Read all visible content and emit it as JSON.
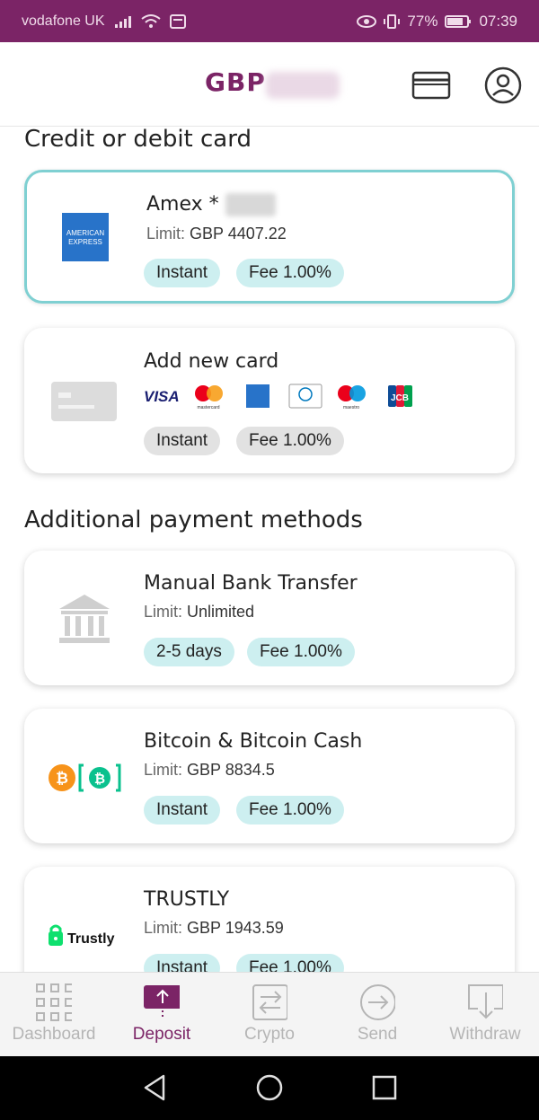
{
  "status_bar": {
    "carrier": "vodafone UK",
    "battery": "77%",
    "time": "07:39"
  },
  "header": {
    "currency": "GBP"
  },
  "sections": {
    "cards_title": "Credit or debit card",
    "additional_title": "Additional payment methods"
  },
  "cards": {
    "amex": {
      "title": "Amex *",
      "limit_label": "Limit:",
      "limit_value": "GBP 4407.22",
      "speed": "Instant",
      "fee": "Fee 1.00%",
      "logo_text_1": "AMERICAN",
      "logo_text_2": "EXPRESS"
    },
    "add_new": {
      "title": "Add new card",
      "speed": "Instant",
      "fee": "Fee 1.00%",
      "brands": {
        "visa": "VISA",
        "mastercard": "mastercard",
        "maestro": "maestro",
        "jcb": "JCB"
      }
    }
  },
  "methods": {
    "bank": {
      "title": "Manual Bank Transfer",
      "limit_label": "Limit:",
      "limit_value": "Unlimited",
      "speed": "2-5 days",
      "fee": "Fee 1.00%"
    },
    "bitcoin": {
      "title": "Bitcoin & Bitcoin Cash",
      "limit_label": "Limit:",
      "limit_value": "GBP 8834.5",
      "speed": "Instant",
      "fee": "Fee 1.00%"
    },
    "trustly": {
      "title": "TRUSTLY",
      "limit_label": "Limit:",
      "limit_value": "GBP 1943.59",
      "speed": "Instant",
      "fee": "Fee 1.00%",
      "logo_text": "Trustly"
    }
  },
  "tabs": [
    {
      "label": "Dashboard",
      "icon": "grid-icon"
    },
    {
      "label": "Deposit",
      "icon": "upload-icon"
    },
    {
      "label": "Crypto",
      "icon": "exchange-icon"
    },
    {
      "label": "Send",
      "icon": "arrow-circle-icon"
    },
    {
      "label": "Withdraw",
      "icon": "download-icon"
    }
  ],
  "colors": {
    "brand": "#7b2466",
    "pill": "#cdeff0",
    "selected_border": "#7fd0d2"
  }
}
